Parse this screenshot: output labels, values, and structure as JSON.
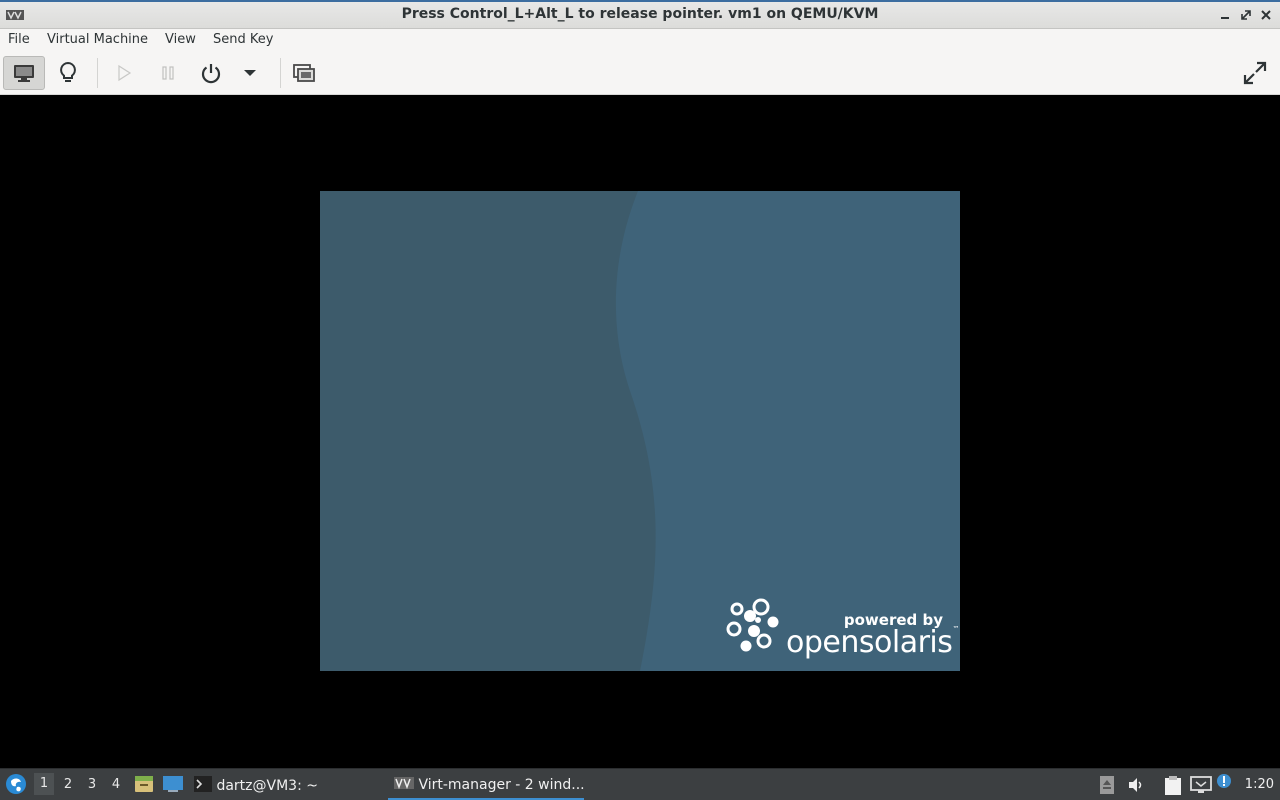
{
  "window": {
    "title": "Press Control_L+Alt_L to release pointer. vm1 on QEMU/KVM",
    "app_icon": "virt-manager-icon",
    "controls": [
      "minimize-icon",
      "maximize-icon",
      "close-icon"
    ]
  },
  "menubar": {
    "items": [
      "File",
      "Virtual Machine",
      "View",
      "Send Key"
    ]
  },
  "toolbar": {
    "buttons": [
      {
        "name": "console-view-button",
        "icon": "monitor-icon",
        "active": true
      },
      {
        "name": "details-view-button",
        "icon": "lightbulb-icon"
      },
      {
        "name": "run-button",
        "icon": "play-icon",
        "enabled": false
      },
      {
        "name": "pause-button",
        "icon": "pause-icon",
        "enabled": false
      },
      {
        "name": "shutdown-button",
        "icon": "power-icon"
      },
      {
        "name": "shutdown-menu-button",
        "icon": "chevron-down-icon"
      },
      {
        "name": "snapshots-button",
        "icon": "snapshot-icon"
      },
      {
        "name": "fullscreen-button",
        "icon": "fullscreen-icon"
      }
    ]
  },
  "vm_display": {
    "powered_by": "powered by",
    "brand": "opensolaris",
    "trademark": "™",
    "colors": {
      "dark": "#3d5b6b",
      "light": "#3f6379"
    }
  },
  "taskbar": {
    "menu_icon": "start-menu-icon",
    "workspaces": [
      "1",
      "2",
      "3",
      "4"
    ],
    "current_workspace": "1",
    "launchers": [
      "file-manager-icon",
      "desktop-icon"
    ],
    "tasks": [
      {
        "icon": "terminal-icon",
        "label": "dartz@VM3: ~",
        "active": false
      },
      {
        "icon": "virt-manager-icon",
        "label": "Virt-manager - 2 wind...",
        "active": true
      }
    ],
    "tray": [
      "eject-icon",
      "volume-icon",
      "clipboard-icon",
      "network-icon",
      "notification-icon"
    ],
    "clock": "1:20"
  }
}
